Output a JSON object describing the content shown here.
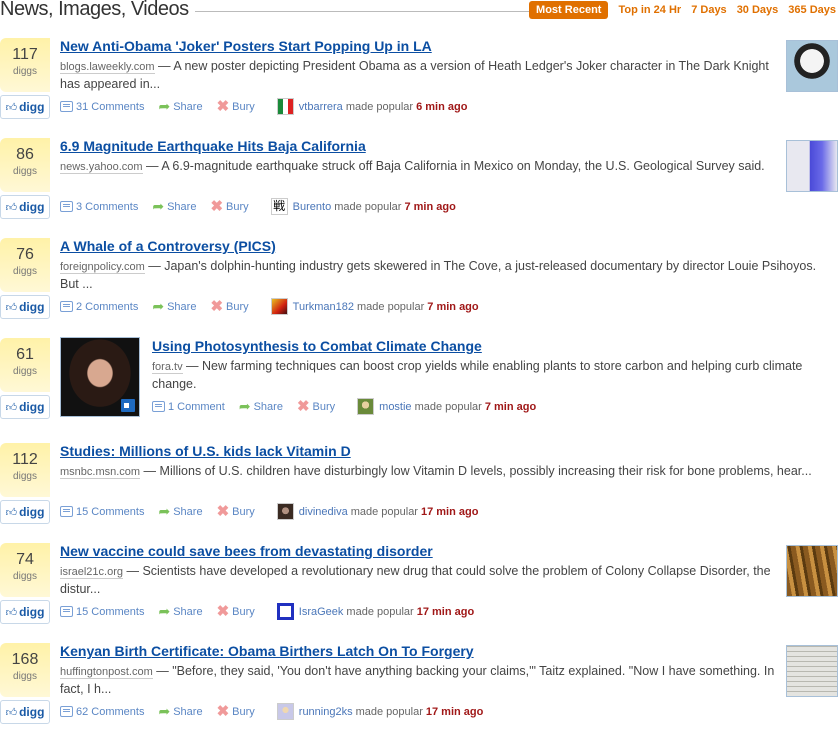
{
  "header": {
    "title": "News, Images, Videos",
    "filters": [
      {
        "label": "Most Recent",
        "active": true
      },
      {
        "label": "Top in 24 Hr",
        "active": false
      },
      {
        "label": "7 Days",
        "active": false
      },
      {
        "label": "30 Days",
        "active": false
      },
      {
        "label": "365 Days",
        "active": false
      }
    ]
  },
  "common": {
    "diggs_label": "diggs",
    "digg_button": "digg",
    "share": "Share",
    "bury": "Bury",
    "made_popular": "made popular",
    "separator": " — "
  },
  "stories": [
    {
      "diggs": "117",
      "title": "New Anti-Obama 'Joker' Posters Start Popping Up in LA",
      "source": "blogs.laweekly.com",
      "description": "A new poster depicting President Obama as a version of Heath Ledger's Joker character in The Dark Knight has appeared in...",
      "comments": "31 Comments",
      "user": "vtbarrera",
      "time": "6 min ago",
      "thumbnail": "joker-poster-thumbnail",
      "avatar": "mexico-flag-avatar"
    },
    {
      "diggs": "86",
      "title": "6.9 Magnitude Earthquake Hits Baja California",
      "source": "news.yahoo.com",
      "description": "A 6.9-magnitude earthquake struck off Baja California in Mexico on Monday, the U.S. Geological Survey said.",
      "comments": "3 Comments",
      "user": "Burento",
      "time": "7 min ago",
      "thumbnail": "seismograph-thumbnail",
      "avatar": "kanji-avatar"
    },
    {
      "diggs": "76",
      "title": "A Whale of a Controversy (PICS)",
      "source": "foreignpolicy.com",
      "description": "Japan's dolphin-hunting industry gets skewered in The Cove, a just-released documentary by director Louie Psihoyos. But ...",
      "comments": "2 Comments",
      "user": "Turkman182",
      "time": "7 min ago",
      "avatar": "red-yellow-avatar"
    },
    {
      "diggs": "61",
      "title": "Using Photosynthesis to Combat Climate Change",
      "source": "fora.tv",
      "description": "New farming techniques can boost crop yields while enabling plants to store carbon and helping curb climate change.",
      "comments": "1 Comment",
      "user": "mostie",
      "time": "7 min ago",
      "thumbnail": "speaker-video-thumbnail",
      "avatar": "figure-avatar"
    },
    {
      "diggs": "112",
      "title": "Studies: Millions of U.S. kids lack Vitamin D",
      "source": "msnbc.msn.com",
      "description": "Millions of U.S. children have disturbingly low Vitamin D levels, possibly increasing their risk for bone problems, hear...",
      "comments": "15 Comments",
      "user": "divinediva",
      "time": "17 min ago",
      "avatar": "portrait-avatar"
    },
    {
      "diggs": "74",
      "title": "New vaccine could save bees from devastating disorder",
      "source": "israel21c.org",
      "description": "Scientists have developed a revolutionary new drug that could solve the problem of Colony Collapse Disorder, the distur...",
      "comments": "15 Comments",
      "user": "IsraGeek",
      "time": "17 min ago",
      "thumbnail": "bees-honeycomb-thumbnail",
      "avatar": "blue-logo-avatar"
    },
    {
      "diggs": "168",
      "title": "Kenyan Birth Certificate: Obama Birthers Latch On To Forgery",
      "source": "huffingtonpost.com",
      "description": "\"Before, they said, 'You don't have anything backing your claims,'\" Taitz explained. \"Now I have something. In fact, I h...",
      "comments": "62 Comments",
      "user": "running2ks",
      "time": "17 min ago",
      "thumbnail": "document-thumbnail",
      "avatar": "cartoon-avatar"
    }
  ]
}
